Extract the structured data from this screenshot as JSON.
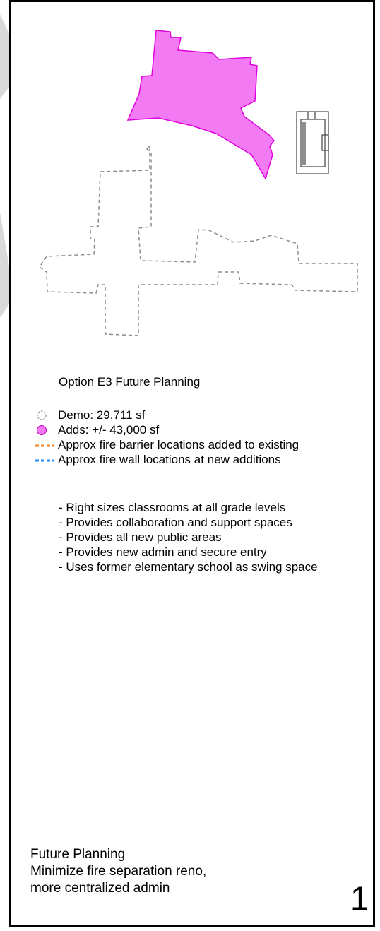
{
  "diagram": {
    "option_title": "Option E3 Future Planning",
    "legend": [
      {
        "icon": "dashed-circle-icon",
        "label": "Demo: 29,711 sf",
        "color": "#999999"
      },
      {
        "icon": "magenta-circle-icon",
        "label": "Adds: +/- 43,000 sf",
        "color": "#ee82ee"
      },
      {
        "icon": "orange-dash-icon",
        "label": "Approx fire barrier locations added to existing",
        "color": "#f58220"
      },
      {
        "icon": "blue-dash-icon",
        "label": "Approx fire wall locations at new additions",
        "color": "#1e8fff"
      }
    ],
    "bullets": [
      "- Right sizes classrooms at all grade levels",
      "- Provides collaboration and support spaces",
      "- Provides all new public areas",
      "- Provides new admin and secure entry",
      "- Uses former elementary school as swing space"
    ],
    "footer": {
      "line1": "Future Planning",
      "line2": "Minimize fire separation reno,",
      "line3": "more centralized admin"
    },
    "page_number": "1"
  }
}
